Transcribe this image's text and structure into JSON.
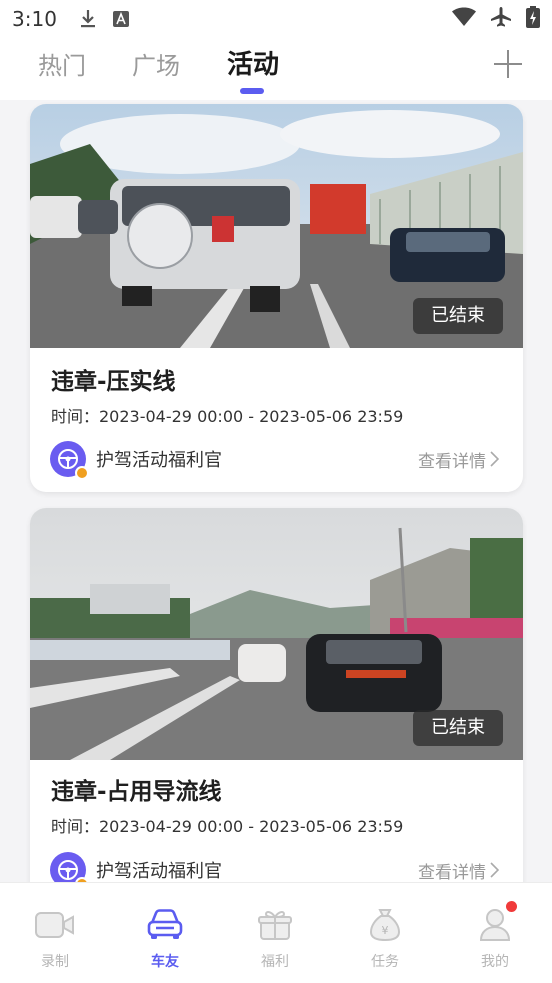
{
  "status_bar": {
    "time": "3:10",
    "icons_left": [
      "download-icon",
      "a-box-icon"
    ],
    "icons_right": [
      "wifi-icon",
      "airplane-icon",
      "battery-icon"
    ]
  },
  "tabs": [
    {
      "label": "热门",
      "active": false
    },
    {
      "label": "广场",
      "active": false
    },
    {
      "label": "活动",
      "active": true
    }
  ],
  "add_icon": "plus-icon",
  "cards": [
    {
      "badge": "已结束",
      "title": "违章-压实线",
      "time": "时间：2023-04-29 00:00 - 2023-05-06 23:59",
      "org_name": "护驾活动福利官",
      "details_label": "查看详情"
    },
    {
      "badge": "已结束",
      "title": "违章-占用导流线",
      "time": "时间：2023-04-29 00:00 - 2023-05-06 23:59",
      "org_name": "护驾活动福利官",
      "details_label": "查看详情"
    }
  ],
  "bottom_nav": [
    {
      "label": "录制",
      "icon": "camera-icon",
      "active": false
    },
    {
      "label": "车友",
      "icon": "car-icon",
      "active": true
    },
    {
      "label": "福利",
      "icon": "gift-icon",
      "active": false
    },
    {
      "label": "任务",
      "icon": "money-bag-icon",
      "active": false
    },
    {
      "label": "我的",
      "icon": "user-icon",
      "active": false,
      "has_notification": true
    }
  ],
  "colors": {
    "accent": "#5b5cf0",
    "notification": "#f03a3a",
    "badge_bg": "#282828"
  }
}
